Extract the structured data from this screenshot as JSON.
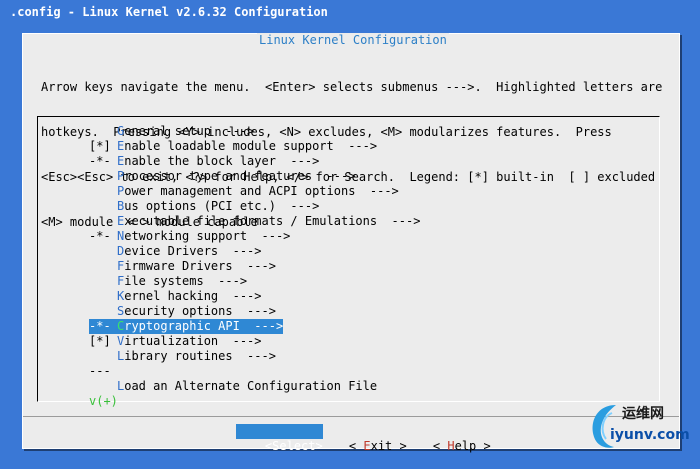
{
  "window": {
    "title": ".config - Linux Kernel v2.6.32 Configuration"
  },
  "dialog": {
    "title": "Linux Kernel Configuration",
    "help_lines": [
      "Arrow keys navigate the menu.  <Enter> selects submenus --->.  Highlighted letters are",
      "hotkeys.  Pressing <Y> includes, <N> excludes, <M> modularizes features.  Press",
      "<Esc><Esc> to exit, <?> for Help, </> for Search.  Legend: [*] built-in  [ ] excluded",
      "<M> module  < > module capable"
    ]
  },
  "menu": {
    "items": [
      {
        "status": "",
        "hotkey": "G",
        "rest": "eneral setup  --->"
      },
      {
        "status": "[*]",
        "hotkey": "E",
        "rest": "nable loadable module support  --->"
      },
      {
        "status": "-*-",
        "hotkey": "E",
        "rest": "nable the block layer  --->"
      },
      {
        "status": "",
        "hotkey": "P",
        "rest": "rocessor type and features  --->"
      },
      {
        "status": "",
        "hotkey": "P",
        "rest": "ower management and ACPI options  --->"
      },
      {
        "status": "",
        "hotkey": "B",
        "rest": "us options (PCI etc.)  --->"
      },
      {
        "status": "",
        "hotkey": "E",
        "rest": "xecutable file formats / Emulations  --->"
      },
      {
        "status": "-*-",
        "hotkey": "N",
        "rest": "etworking support  --->"
      },
      {
        "status": "",
        "hotkey": "D",
        "rest": "evice Drivers  --->"
      },
      {
        "status": "",
        "hotkey": "F",
        "rest": "irmware Drivers  --->"
      },
      {
        "status": "",
        "hotkey": "F",
        "rest": "ile systems  --->"
      },
      {
        "status": "",
        "hotkey": "K",
        "rest": "ernel hacking  --->"
      },
      {
        "status": "",
        "hotkey": "S",
        "rest": "ecurity options  --->"
      },
      {
        "status": "-*-",
        "hotkey": "C",
        "rest": "ryptographic API  --->",
        "selected": true
      },
      {
        "status": "[*]",
        "hotkey": "V",
        "rest": "irtualization  --->"
      },
      {
        "status": "",
        "hotkey": "L",
        "rest": "ibrary routines  --->"
      },
      {
        "status": "---",
        "hotkey": "",
        "rest": ""
      },
      {
        "status": "",
        "hotkey": "L",
        "rest": "oad an Alternate Configuration File"
      }
    ],
    "more_indicator": "v(+)"
  },
  "buttons": {
    "select": {
      "pre": "",
      "hot": "S",
      "post": "elect",
      "brackets": [
        "<",
        ">"
      ]
    },
    "exit": {
      "pre": "",
      "hot": "E",
      "post": "xit",
      "brackets": [
        "< ",
        " >"
      ]
    },
    "help": {
      "pre": "",
      "hot": "H",
      "post": "elp",
      "brackets": [
        "< ",
        " >"
      ]
    }
  },
  "watermark": {
    "top_text": "运维网",
    "bottom_text": "iyunv.com"
  },
  "colors": {
    "background": "#3a78d6",
    "dialog_bg": "#ececec",
    "highlight": "#2f88d4",
    "hotkey": "#2f6ec9",
    "indicator": "#39c03a"
  }
}
